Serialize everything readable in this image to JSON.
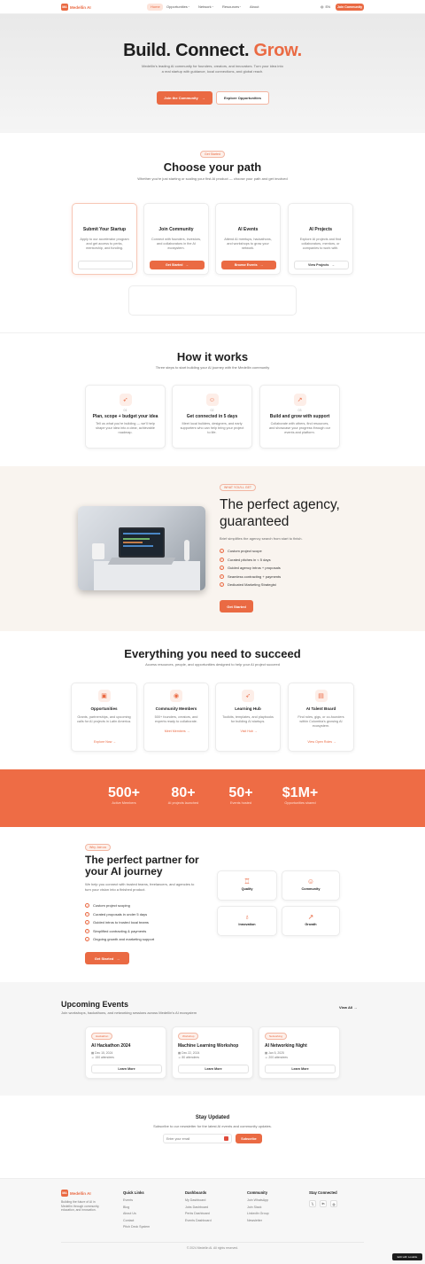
{
  "brand": {
    "name": "Medellin AI",
    "logo_text": "MA",
    "accent": "#ea6a43"
  },
  "nav": {
    "items": [
      "Home",
      "Opportunities",
      "Network",
      "Resources",
      "About"
    ],
    "lang": "EN",
    "cta": "Join Community"
  },
  "hero": {
    "title_a": "Build. Connect.",
    "title_b": "Grow.",
    "subtitle": "Medellin's leading AI community for founders, creators, and innovators. Turn your idea into a real startup with guidance, local connections, and global reach.",
    "primary_btn": "Join the Community",
    "secondary_btn": "Explore Opportunities"
  },
  "path": {
    "badge": "Get Started",
    "title": "Choose your path",
    "subtitle": "Whether you're just starting or scaling your first AI product — choose your path and get involved",
    "cards": [
      {
        "title": "Submit Your Startup",
        "text": "Apply to our accelerator program and get access to perks, mentorship, and funding.",
        "btn": ""
      },
      {
        "title": "Join Community",
        "text": "Connect with founders, investors, and collaborators in the AI ecosystem.",
        "btn": "Get Started"
      },
      {
        "title": "AI Events",
        "text": "Attend AI meetups, hackathons, and workshops to grow your network.",
        "btn": "Browse Events"
      },
      {
        "title": "AI Projects",
        "text": "Explore AI projects and find collaborators, mentors, or companies to work with.",
        "btn": "View Projects"
      }
    ]
  },
  "how": {
    "title": "How it works",
    "subtitle": "Three steps to start building your AI journey with the Medellin community",
    "steps": [
      {
        "num": "01",
        "icon": "rocket-icon",
        "title": "Plan, scope + budget your idea",
        "text": "Tell us what you're building — we'll help shape your idea into a clear, achievable roadmap."
      },
      {
        "num": "02",
        "icon": "users-icon",
        "title": "Get connected in 5 days",
        "text": "Meet local builders, designers, and early supporters who can help bring your project to life."
      },
      {
        "num": "03",
        "icon": "trending-up-icon",
        "title": "Build and grow with support",
        "text": "Collaborate with others, find resources, and showcase your progress through our events and platform."
      }
    ]
  },
  "agency": {
    "badge": "WHAT YOU'LL GET",
    "title": "The perfect agency, guaranteed",
    "subtitle": "Brief simplifies the agency search from start to finish.",
    "items": [
      "Custom project scope",
      "Curated pitches in < 5 days",
      "Guided agency intros + proposals",
      "Seamless contracting + payments",
      "Dedicated Marketing Strategist"
    ],
    "btn": "Get Started"
  },
  "succeed": {
    "title": "Everything you need to succeed",
    "subtitle": "Access resources, people, and opportunities designed to help your AI project succeed",
    "cards": [
      {
        "icon": "gift-icon",
        "title": "Opportunities",
        "text": "Grants, partnerships, and upcoming calls for AI projects in Latin America.",
        "link": "Explore Now"
      },
      {
        "icon": "eye-icon",
        "title": "Community Members",
        "text": "500+ founders, creators, and experts ready to collaborate.",
        "link": "Meet Members"
      },
      {
        "icon": "rocket-icon",
        "title": "Learning Hub",
        "text": "Toolkits, templates, and playbooks for building AI startups.",
        "link": "Visit Hub"
      },
      {
        "icon": "briefcase-icon",
        "title": "AI Talent Board",
        "text": "Find roles, gigs, or co-founders within Colombia's growing AI ecosystem.",
        "link": "View Open Roles"
      }
    ]
  },
  "stats": [
    {
      "num": "500+",
      "label": "Active Members"
    },
    {
      "num": "80+",
      "label": "AI projects launched"
    },
    {
      "num": "50+",
      "label": "Events hosted"
    },
    {
      "num": "$1M+",
      "label": "Opportunities shared"
    }
  ],
  "partner": {
    "badge": "Why Join us",
    "title": "The perfect partner for your AI journey",
    "subtitle": "We help you connect with trusted teams, freelancers, and agencies to turn your vision into a finished product.",
    "items": [
      "Custom project scoping",
      "Curated proposals in under 5 days",
      "Guided intros to trusted local teams",
      "Simplified contracting & payments",
      "Ongoing growth and marketing support"
    ],
    "btn": "Get Started",
    "tiles": [
      {
        "icon": "award-icon",
        "label": "Quality"
      },
      {
        "icon": "users-icon",
        "label": "Community"
      },
      {
        "icon": "bulb-icon",
        "label": "Innovation"
      },
      {
        "icon": "trending-up-icon",
        "label": "Growth"
      }
    ]
  },
  "events": {
    "title": "Upcoming Events",
    "subtitle": "Join workshops, hackathons, and networking sessions across Medellín's AI ecosystem",
    "view_all": "View All",
    "items": [
      {
        "tag": "Hackathon",
        "title": "AI Hackathon 2024",
        "date": "Dec 15, 2024",
        "att": "150 attendees",
        "btn": "Learn More"
      },
      {
        "tag": "Workshop",
        "title": "Machine Learning Workshop",
        "date": "Dec 22, 2024",
        "att": "80 attendees",
        "btn": "Learn More"
      },
      {
        "tag": "Networking",
        "title": "AI Networking Night",
        "date": "Jan 5, 2025",
        "att": "200 attendees",
        "btn": "Learn More"
      }
    ]
  },
  "newsletter": {
    "title": "Stay Updated",
    "subtitle": "Subscribe to our newsletter for the latest AI events and community updates.",
    "placeholder": "Enter your email",
    "btn": "Subscribe"
  },
  "footer": {
    "about": "Building the future of AI in Medellín through community, education, and innovation.",
    "cols": [
      {
        "title": "Quick Links",
        "links": [
          "Events",
          "Blog",
          "About Us",
          "Contact",
          "Pitch Deck System"
        ]
      },
      {
        "title": "Dashboards",
        "links": [
          "My Dashboard",
          "Jobs Dashboard",
          "Perks Dashboard",
          "Events Dashboard"
        ]
      },
      {
        "title": "Community",
        "links": [
          "Join WhatsApp",
          "Join Slack",
          "LinkedIn Group",
          "Newsletter"
        ]
      },
      {
        "title": "Stay Connected",
        "links": []
      }
    ],
    "copyright": "© 2024 Medellin AI. All rights reserved.",
    "badge": "Edit with Lovable"
  }
}
